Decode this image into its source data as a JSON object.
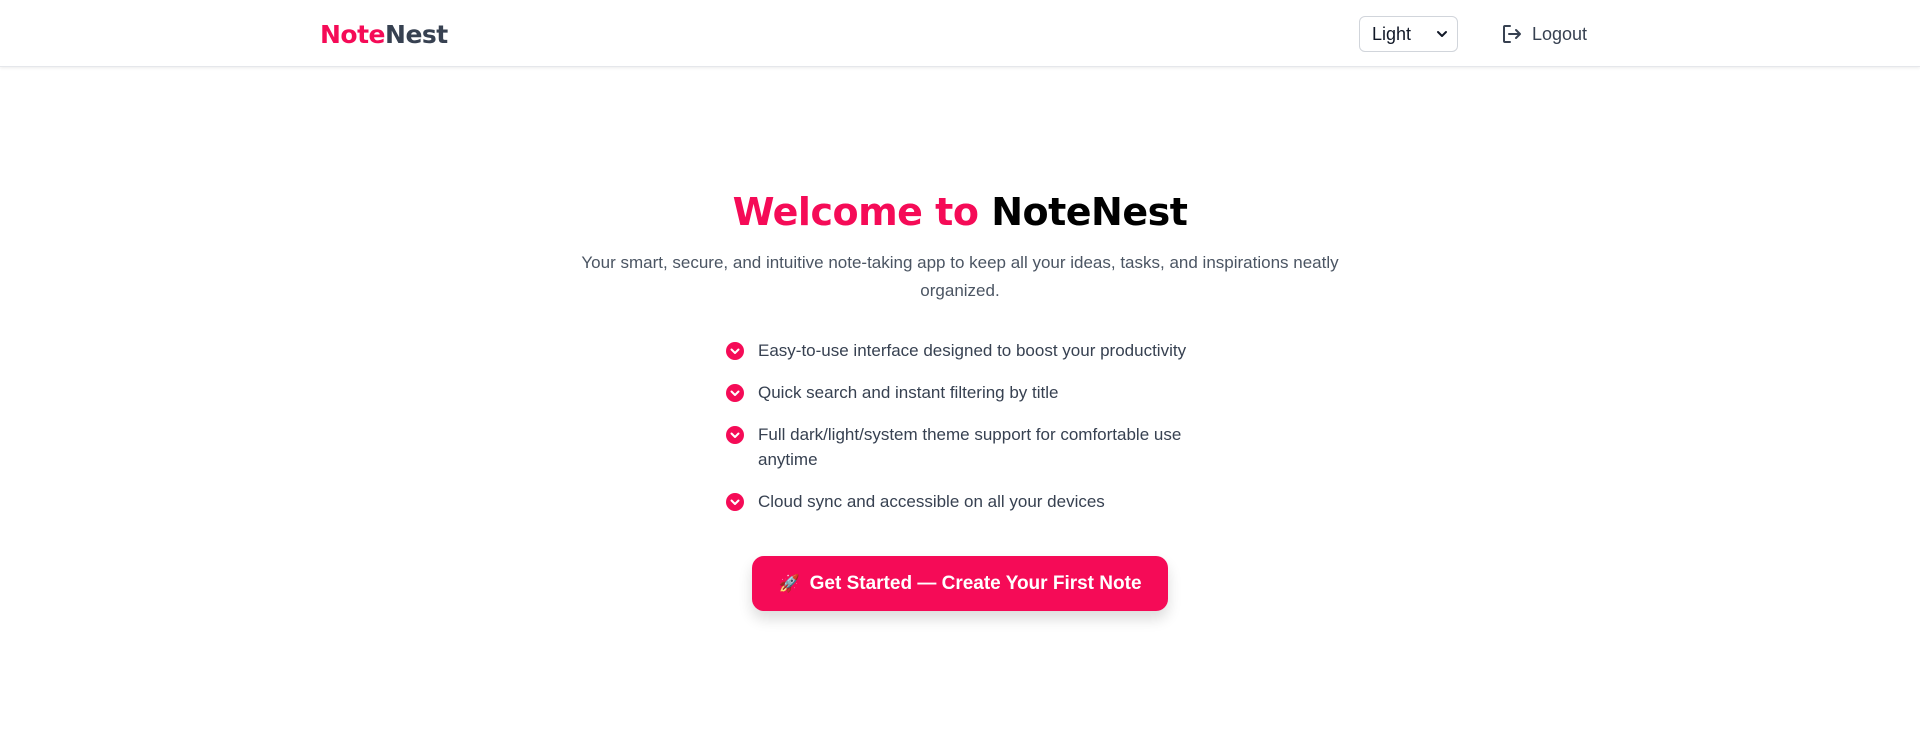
{
  "navbar": {
    "brand_part1": "Note",
    "brand_part2": "Nest",
    "theme_select": {
      "selected": "Light"
    },
    "logout_label": "Logout"
  },
  "hero": {
    "title_accent": "Welcome to",
    "title_brand": "NoteNest",
    "subtitle": "Your smart, secure, and intuitive note-taking app to keep all your ideas, tasks, and inspirations neatly organized."
  },
  "features": [
    {
      "text": "Easy-to-use interface designed to boost your productivity"
    },
    {
      "text": "Quick search and instant filtering by title"
    },
    {
      "text": "Full dark/light/system theme support for comfortable use anytime"
    },
    {
      "text": "Cloud sync and accessible on all your devices"
    }
  ],
  "cta": {
    "icon": "🚀",
    "label": "Get Started — Create Your First Note"
  },
  "colors": {
    "accent": "#f50b57",
    "text_dark": "#374151",
    "text_muted": "#4b5563"
  },
  "icons": {
    "theme_select_chevron": "chevron-down-icon",
    "logout": "logout-icon",
    "feature_bullet": "check-circle-icon",
    "cta": "rocket-icon"
  }
}
